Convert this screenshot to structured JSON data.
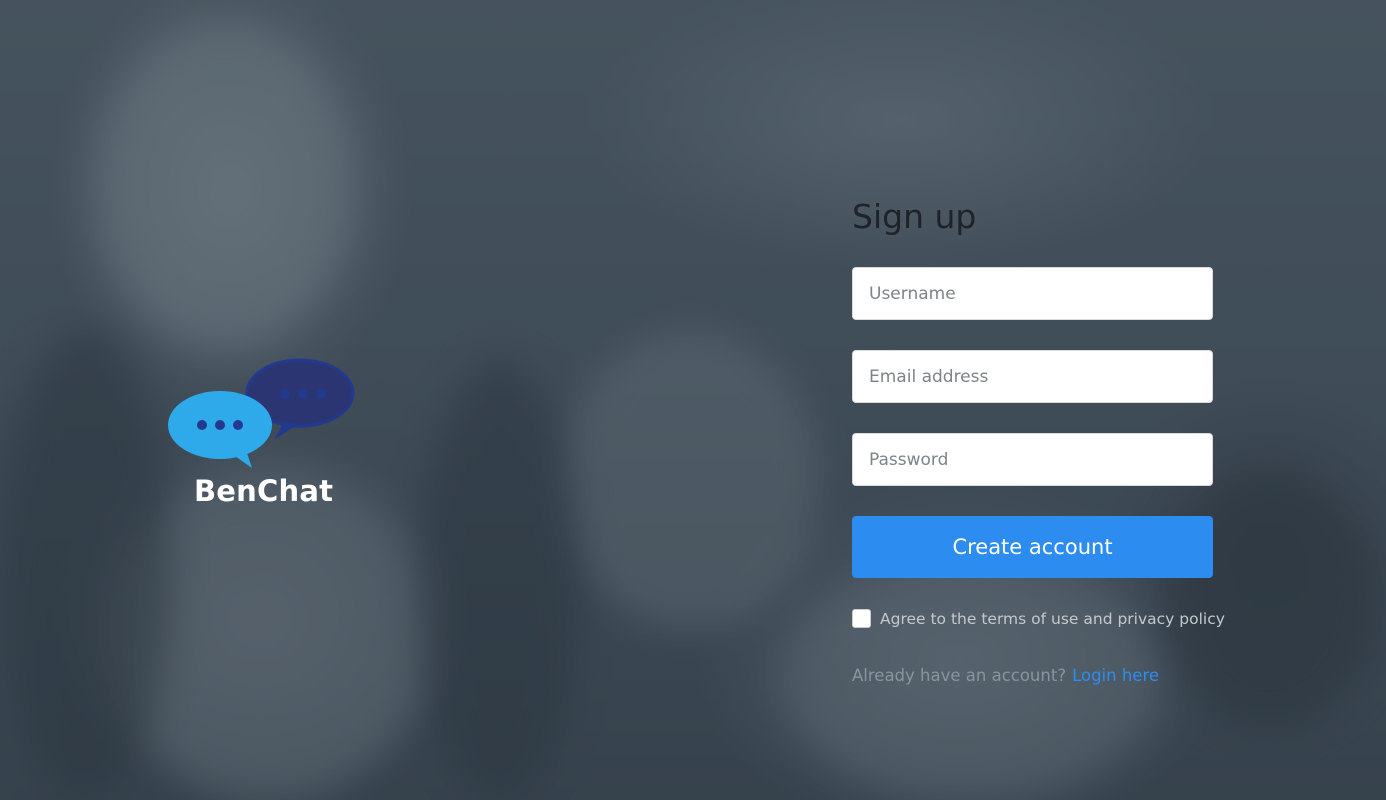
{
  "brand": {
    "name": "BenChat"
  },
  "signup": {
    "title": "Sign up",
    "username_placeholder": "Username",
    "email_placeholder": "Email address",
    "password_placeholder": "Password",
    "submit_label": "Create account",
    "terms_label": "Agree to the terms of use and privacy policy",
    "login_prompt": "Already have an account?",
    "login_link": "Login here"
  },
  "colors": {
    "accent": "#2d8cf0",
    "bubble_light": "#2ea9ea",
    "bubble_dark": "#23398f"
  },
  "icons": {
    "logo": "chat-bubbles-icon"
  }
}
